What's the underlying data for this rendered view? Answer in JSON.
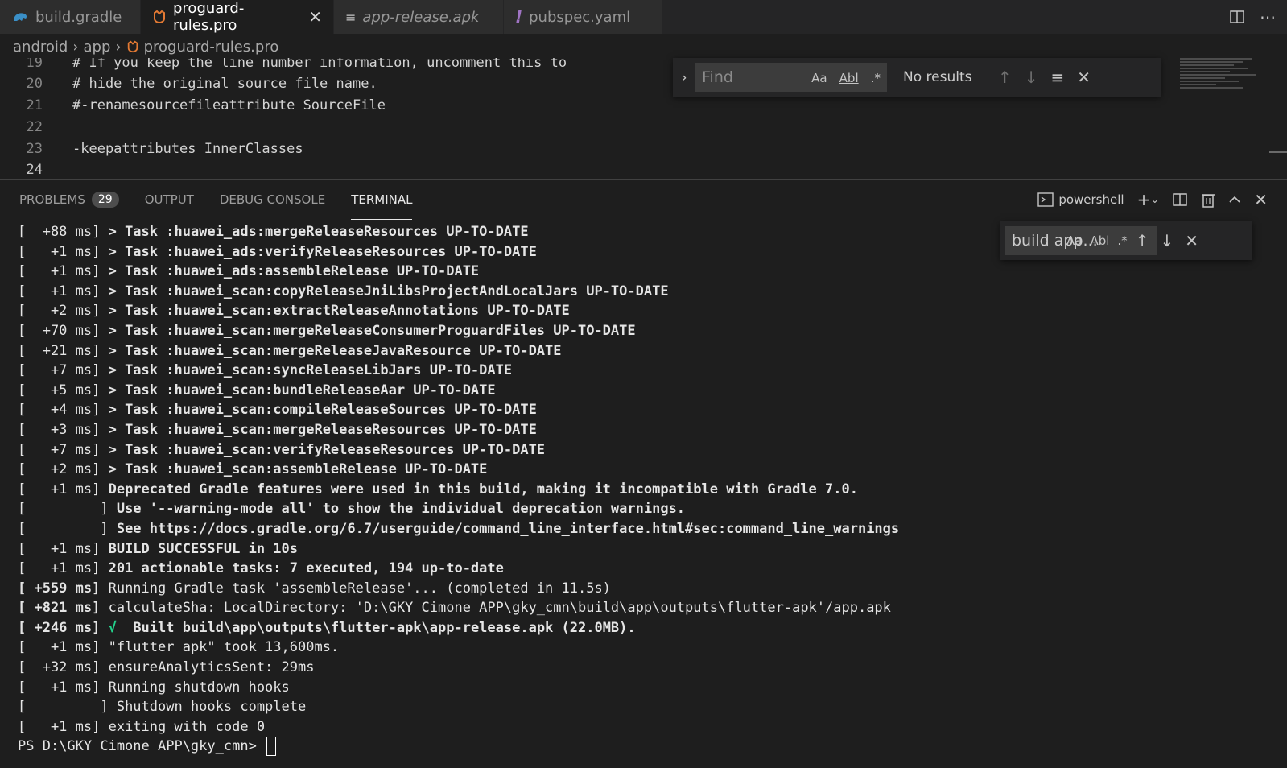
{
  "tabs": [
    {
      "icon": "gradle-icon",
      "label": "build.gradle",
      "active": false,
      "italic": false
    },
    {
      "icon": "proguard-icon",
      "label": "proguard-rules.pro",
      "active": true,
      "italic": false
    },
    {
      "icon": "binary-file-icon",
      "label": "app-release.apk",
      "active": false,
      "italic": true
    },
    {
      "icon": "yaml-icon",
      "label": "pubspec.yaml",
      "active": false,
      "italic": false
    }
  ],
  "breadcrumb": {
    "parts": [
      "android",
      "app",
      "proguard-rules.pro"
    ]
  },
  "editor": {
    "lines": [
      {
        "num": "19",
        "text": "# If you keep the line number information, uncomment this to"
      },
      {
        "num": "20",
        "text": "# hide the original source file name."
      },
      {
        "num": "21",
        "text": "#-renamesourcefileattribute SourceFile"
      },
      {
        "num": "22",
        "text": ""
      },
      {
        "num": "23",
        "text": "-keepattributes InnerClasses"
      },
      {
        "num": "24",
        "text": ""
      }
    ]
  },
  "find": {
    "placeholder": "Find",
    "status": "No results",
    "opt_case": "Aa",
    "opt_word": "Abl",
    "opt_regex": ".*"
  },
  "panel": {
    "tabs": [
      {
        "label": "PROBLEMS",
        "badge": "29"
      },
      {
        "label": "OUTPUT"
      },
      {
        "label": "DEBUG CONSOLE"
      },
      {
        "label": "TERMINAL",
        "active": true
      }
    ],
    "shell": "powershell"
  },
  "terminal_find": {
    "value": "build app...",
    "opt_case": "Aa",
    "opt_word": "Abl",
    "opt_regex": ".*"
  },
  "terminal": {
    "lines": [
      {
        "prefix": "[  +88 ms] ",
        "text": "> Task :huawei_ads:mergeReleaseResources UP-TO-DATE",
        "bold": true
      },
      {
        "prefix": "[   +1 ms] ",
        "text": "> Task :huawei_ads:verifyReleaseResources UP-TO-DATE",
        "bold": true
      },
      {
        "prefix": "[   +1 ms] ",
        "text": "> Task :huawei_ads:assembleRelease UP-TO-DATE",
        "bold": true
      },
      {
        "prefix": "[   +1 ms] ",
        "text": "> Task :huawei_scan:copyReleaseJniLibsProjectAndLocalJars UP-TO-DATE",
        "bold": true
      },
      {
        "prefix": "[   +2 ms] ",
        "text": "> Task :huawei_scan:extractReleaseAnnotations UP-TO-DATE",
        "bold": true
      },
      {
        "prefix": "[  +70 ms] ",
        "text": "> Task :huawei_scan:mergeReleaseConsumerProguardFiles UP-TO-DATE",
        "bold": true
      },
      {
        "prefix": "[  +21 ms] ",
        "text": "> Task :huawei_scan:mergeReleaseJavaResource UP-TO-DATE",
        "bold": true
      },
      {
        "prefix": "[   +7 ms] ",
        "text": "> Task :huawei_scan:syncReleaseLibJars UP-TO-DATE",
        "bold": true
      },
      {
        "prefix": "[   +5 ms] ",
        "text": "> Task :huawei_scan:bundleReleaseAar UP-TO-DATE",
        "bold": true
      },
      {
        "prefix": "[   +4 ms] ",
        "text": "> Task :huawei_scan:compileReleaseSources UP-TO-DATE",
        "bold": true
      },
      {
        "prefix": "[   +3 ms] ",
        "text": "> Task :huawei_scan:mergeReleaseResources UP-TO-DATE",
        "bold": true
      },
      {
        "prefix": "[   +7 ms] ",
        "text": "> Task :huawei_scan:verifyReleaseResources UP-TO-DATE",
        "bold": true
      },
      {
        "prefix": "[   +2 ms] ",
        "text": "> Task :huawei_scan:assembleRelease UP-TO-DATE",
        "bold": true
      },
      {
        "prefix": "[   +1 ms] ",
        "text": "Deprecated Gradle features were used in this build, making it incompatible with Gradle 7.0.",
        "bold": true
      },
      {
        "prefix": "[         ] ",
        "text": "Use '--warning-mode all' to show the individual deprecation warnings.",
        "bold": true
      },
      {
        "prefix": "[         ] ",
        "text": "See https://docs.gradle.org/6.7/userguide/command_line_interface.html#sec:command_line_warnings",
        "bold": true
      },
      {
        "prefix": "[   +1 ms] ",
        "text": "BUILD SUCCESSFUL in 10s",
        "bold": true
      },
      {
        "prefix": "[   +1 ms] ",
        "text": "201 actionable tasks: 7 executed, 194 up-to-date",
        "bold": true
      },
      {
        "prefix": "[ +559 ms] ",
        "text": "Running Gradle task 'assembleRelease'... (completed in 11.5s)",
        "bold": false,
        "bold_prefix": true
      },
      {
        "prefix": "[ +821 ms] ",
        "text": "calculateSha: LocalDirectory: 'D:\\GKY Cimone APP\\gky_cmn\\build\\app\\outputs\\flutter-apk'/app.apk",
        "bold": false,
        "bold_prefix": true
      },
      {
        "prefix": "[ +246 ms] ",
        "check": "√",
        "text": "  Built build\\app\\outputs\\flutter-apk\\app-release.apk (22.0MB).",
        "bold": true,
        "bold_prefix": true
      },
      {
        "prefix": "[   +1 ms] ",
        "text": "\"flutter apk\" took 13,600ms.",
        "bold": false
      },
      {
        "prefix": "[  +32 ms] ",
        "text": "ensureAnalyticsSent: 29ms",
        "bold": false
      },
      {
        "prefix": "[   +1 ms] ",
        "text": "Running shutdown hooks",
        "bold": false
      },
      {
        "prefix": "[         ] ",
        "text": "Shutdown hooks complete",
        "bold": false
      },
      {
        "prefix": "[   +1 ms] ",
        "text": "exiting with code 0",
        "bold": false
      }
    ],
    "prompt": "PS D:\\GKY Cimone APP\\gky_cmn> "
  },
  "colors": {
    "accent_success": "#23d18b",
    "background": "#1e1e1e",
    "tab_inactive": "#2d2d2d"
  }
}
